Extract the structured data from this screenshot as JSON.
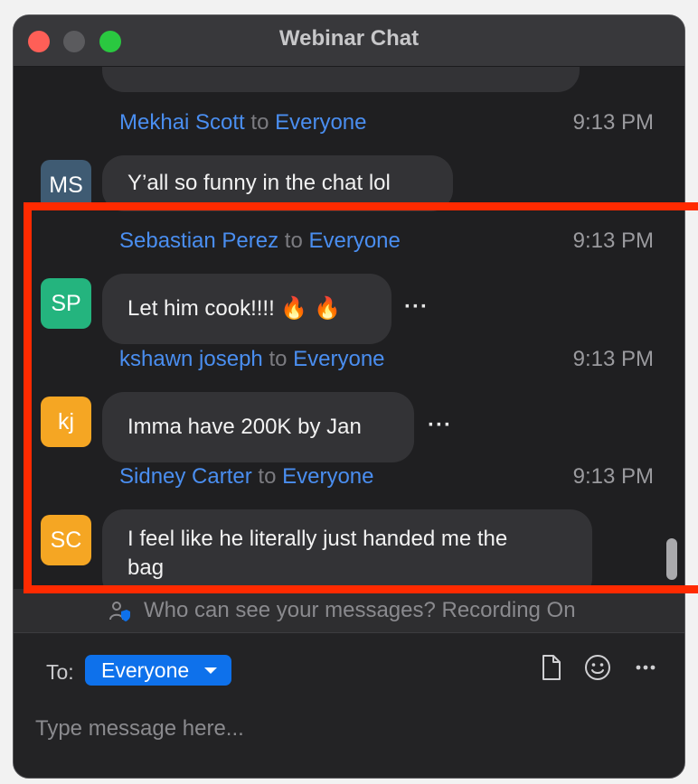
{
  "window": {
    "title": "Webinar Chat"
  },
  "messages": [
    {
      "sender": "Mekhai Scott",
      "to_word": "to",
      "recipient": "Everyone",
      "time": "9:13 PM",
      "initials": "MS",
      "avatar_color": "#3f5b73",
      "text": "Y’all so funny in the chat lol"
    },
    {
      "sender": "Sebastian Perez",
      "to_word": "to",
      "recipient": "Everyone",
      "time": "9:13 PM",
      "initials": "SP",
      "avatar_color": "#24b47e",
      "text": "Let him cook!!!! 🔥 🔥"
    },
    {
      "sender": "kshawn joseph",
      "to_word": "to",
      "recipient": "Everyone",
      "time": "9:13 PM",
      "initials": "kj",
      "avatar_color": "#f5a623",
      "text": "Imma have 200K by Jan"
    },
    {
      "sender": "Sidney Carter",
      "to_word": "to",
      "recipient": "Everyone",
      "time": "9:13 PM",
      "initials": "SC",
      "avatar_color": "#f5a623",
      "text_line1": "I feel like he literally just handed me the",
      "text_line2": "bag"
    }
  ],
  "more_glyph": "···",
  "notice": {
    "text": "Who can see your messages? Recording On"
  },
  "compose": {
    "to_label": "To:",
    "recipient": "Everyone",
    "placeholder": "Type message here..."
  },
  "icons": [
    "file-icon",
    "emoji-icon",
    "more-icon",
    "people-icon"
  ],
  "colors": {
    "highlight": "#ff2a00",
    "accent": "#0e71eb",
    "name": "#4a8ef0"
  }
}
